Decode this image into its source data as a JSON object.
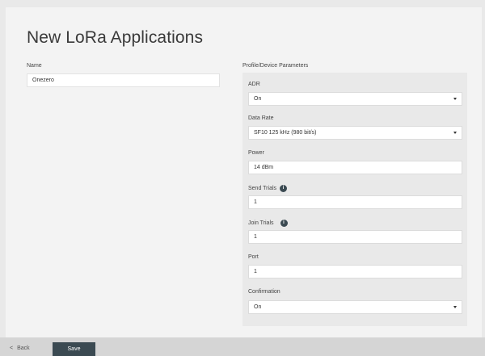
{
  "page": {
    "title": "New LoRa Applications"
  },
  "name_field": {
    "label": "Name",
    "value": "Onezero"
  },
  "profile": {
    "heading": "Profile/Device Parameters",
    "adr": {
      "label": "ADR",
      "value": "On"
    },
    "data_rate": {
      "label": "Data Rate",
      "value": "SF10 125 kHz (980 bit/s)"
    },
    "power": {
      "label": "Power",
      "value": "14 dBm"
    },
    "send_trials": {
      "label": "Send Trials",
      "value": "1",
      "info_icon": "i"
    },
    "join_trials": {
      "label": "Join Trials",
      "value": "1",
      "info_icon": "i"
    },
    "port": {
      "label": "Port",
      "value": "1"
    },
    "confirmation": {
      "label": "Confirmation",
      "value": "On"
    }
  },
  "footer": {
    "back_glyph": "<",
    "back_label": "Back",
    "save_label": "Save"
  },
  "colors": {
    "accent": "#3b4a52",
    "panel": "#e9e9e9",
    "page_bg": "#f3f3f3"
  }
}
